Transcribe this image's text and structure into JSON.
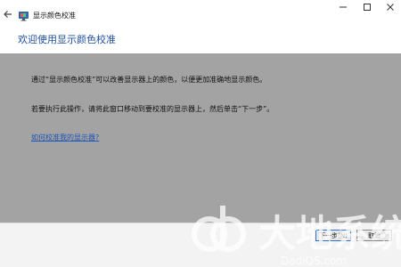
{
  "titlebar": {
    "title": "显示颜色校准",
    "back_icon": "back-arrow-icon",
    "app_icon": "monitor-icon",
    "minimize_icon": "minimize-icon",
    "maximize_icon": "maximize-icon",
    "close_icon": "close-icon"
  },
  "main": {
    "heading": "欢迎使用显示颜色校准",
    "paragraphs": [
      "通过“显示颜色校准”可以改善显示器上的颜色，以便更加准确地显示颜色。",
      "若要执行此操作，请将此窗口移动到要校准的显示器上，然后单击“下一步”。"
    ],
    "help_link": "如何校准我的显示器?"
  },
  "footer": {
    "next_label": "下一步(N)",
    "cancel_label": "取消"
  },
  "watermark": {
    "text": "大地系统",
    "subtext": "DadiQS.com"
  },
  "colors": {
    "heading": "#1f4e9c",
    "content_bg": "#a3a3a3",
    "link": "#1e54b8"
  }
}
